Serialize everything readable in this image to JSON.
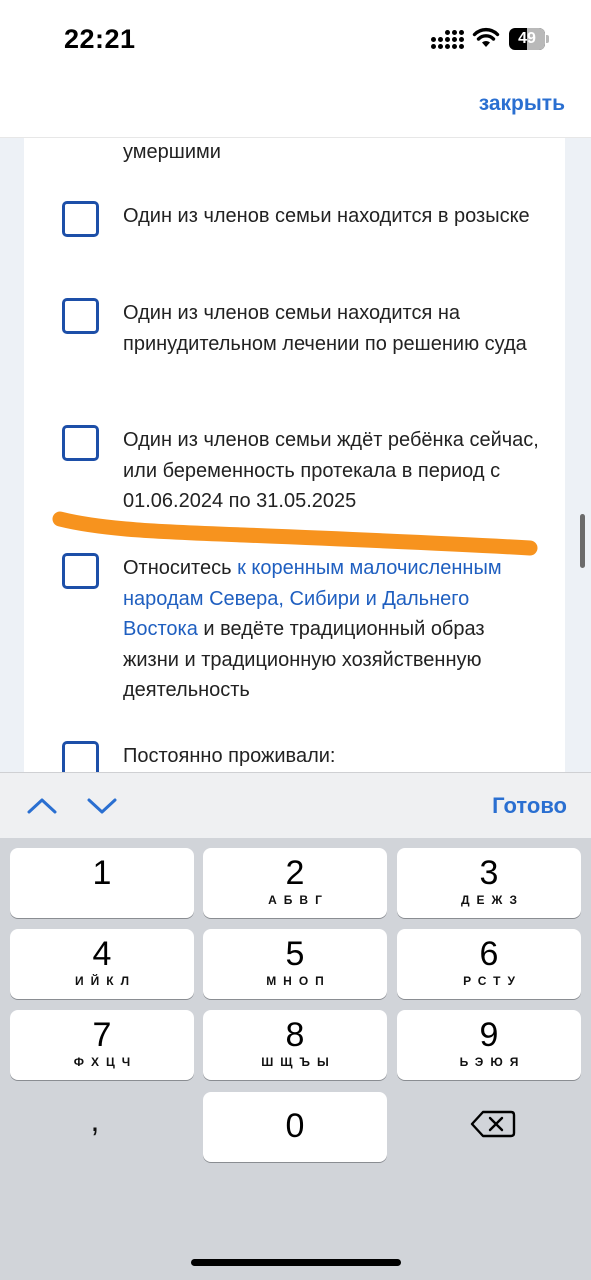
{
  "status_bar": {
    "time": "22:21",
    "battery": "49"
  },
  "header": {
    "close_label": "закрыть"
  },
  "options": [
    {
      "text": "умершими"
    },
    {
      "text": "Один из членов семьи находится в розыске"
    },
    {
      "text": "Один из членов семьи находится на принудительном лечении по решению суда"
    },
    {
      "text": "Один из членов семьи ждёт ребёнка сейчас, или беременность протекала в период с 01.06.2024 по 31.05.2025"
    },
    {
      "text_before": "Относитесь ",
      "link": "к коренным малочисленным народам Севера, Сибири и Дальнего Востока",
      "text_after": " и ведёте традиционный образ жизни и традиционную хозяйственную деятельность"
    },
    {
      "text": "Постоянно проживали:"
    }
  ],
  "keyboard": {
    "done_label": "Готово",
    "keys": [
      {
        "num": "1",
        "letters": ""
      },
      {
        "num": "2",
        "letters": "АБВГ"
      },
      {
        "num": "3",
        "letters": "ДЕЖЗ"
      },
      {
        "num": "4",
        "letters": "ИЙКЛ"
      },
      {
        "num": "5",
        "letters": "МНОП"
      },
      {
        "num": "6",
        "letters": "РСТУ"
      },
      {
        "num": "7",
        "letters": "ФХЦЧ"
      },
      {
        "num": "8",
        "letters": "ШЩЪЫ"
      },
      {
        "num": "9",
        "letters": "ЬЭЮЯ"
      },
      {
        "num": "0",
        "letters": ""
      }
    ],
    "comma": ","
  },
  "colors": {
    "accent": "#2a6fd1",
    "checkbox_border": "#1d4fa8",
    "marker": "#f7931e"
  }
}
